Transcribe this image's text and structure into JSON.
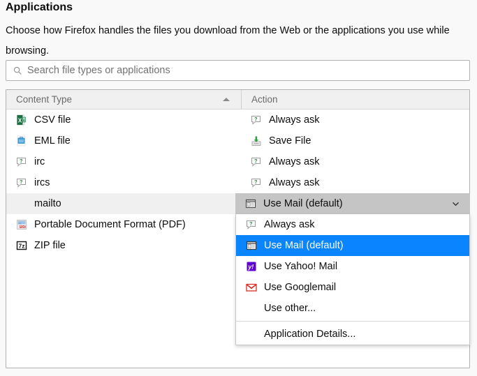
{
  "header": {
    "title": "Applications",
    "description": "Choose how Firefox handles the files you download from the Web or the applications you use while browsing."
  },
  "search": {
    "value": "",
    "placeholder": "Search file types or applications",
    "icon": "search-icon"
  },
  "table": {
    "columns": [
      {
        "label": "Content Type",
        "sort": "ascending",
        "sort_icon": "sort-ascending-icon"
      },
      {
        "label": "Action"
      }
    ],
    "rows": [
      {
        "type": "CSV file",
        "type_icon": "csv-file-icon",
        "action": "Always ask",
        "action_icon": "always-ask-icon",
        "selected": false
      },
      {
        "type": "EML file",
        "type_icon": "eml-file-icon",
        "action": "Save File",
        "action_icon": "save-file-icon",
        "selected": false
      },
      {
        "type": "irc",
        "type_icon": "always-ask-icon",
        "action": "Always ask",
        "action_icon": "always-ask-icon",
        "selected": false
      },
      {
        "type": "ircs",
        "type_icon": "always-ask-icon",
        "action": "Always ask",
        "action_icon": "always-ask-icon",
        "selected": false
      },
      {
        "type": "mailto",
        "type_icon": "none",
        "action": "",
        "action_icon": "none",
        "selected": true
      },
      {
        "type": "Portable Document Format (PDF)",
        "type_icon": "pdf-file-icon",
        "action": "",
        "action_icon": "none",
        "selected": false
      },
      {
        "type": "ZIP file",
        "type_icon": "zip-file-icon",
        "action": "",
        "action_icon": "none",
        "selected": false
      }
    ]
  },
  "combobox": {
    "selected_label": "Use Mail (default)",
    "selected_icon": "mail-app-icon",
    "chevron_icon": "chevron-down-icon",
    "expanded": true,
    "options": [
      {
        "label": "Always ask",
        "icon": "always-ask-icon",
        "highlighted": false,
        "separator_before": false
      },
      {
        "label": "Use Mail (default)",
        "icon": "mail-app-icon",
        "highlighted": true,
        "separator_before": false
      },
      {
        "label": "Use Yahoo! Mail",
        "icon": "yahoo-mail-icon",
        "highlighted": false,
        "separator_before": false
      },
      {
        "label": "Use Googlemail",
        "icon": "googlemail-icon",
        "highlighted": false,
        "separator_before": false
      },
      {
        "label": "Use other...",
        "icon": "none",
        "highlighted": false,
        "separator_before": false
      },
      {
        "label": "Application Details...",
        "icon": "none",
        "highlighted": false,
        "separator_before": true
      }
    ]
  },
  "colors": {
    "accent": "#0a84ff",
    "page_background": "#f9f9f9",
    "panel_background": "#ffffff",
    "header_background": "#f0f0f0",
    "selected_row": "#f0f0f0",
    "combobox_background": "#c5c5c5",
    "border": "#b1b1b1",
    "text": "#0c0c0d",
    "muted_text": "#6a6a6a"
  }
}
